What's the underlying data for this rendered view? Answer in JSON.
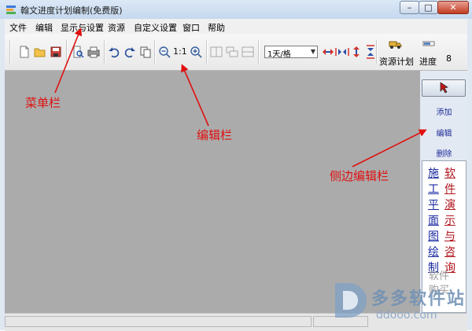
{
  "window": {
    "title": "翰文进度计划编制(免费版)",
    "controls": {
      "minimize": "–",
      "maximize": "□",
      "close": "✕"
    }
  },
  "menubar": {
    "items": [
      "文件",
      "编辑",
      "显示与设置",
      "资源",
      "自定义设置",
      "窗口",
      "帮助"
    ]
  },
  "toolbar": {
    "zoom_reset_label": "1:1",
    "time_scale": {
      "selected": "1天/格"
    },
    "resource_plan_label": "资源计划",
    "progress_label": "进度",
    "overflow_label": "8"
  },
  "side_panel": {
    "add": "添加",
    "edit": "编辑",
    "delete": "删除",
    "left_link": "施工平面图绘制",
    "right_link": "软件演示与咨询",
    "bottom_text": "软件购买"
  },
  "annotations": {
    "menubar": "菜单栏",
    "edit_toolbar": "编辑栏",
    "side_edit_bar": "侧边编辑栏"
  },
  "watermark": {
    "brand": "多多软件站",
    "url": "ddooo.com"
  },
  "colors": {
    "annotation": "#e01010",
    "workspace": "#ababab",
    "link_blue": "#1a2aa0",
    "link_red": "#b0141c"
  }
}
